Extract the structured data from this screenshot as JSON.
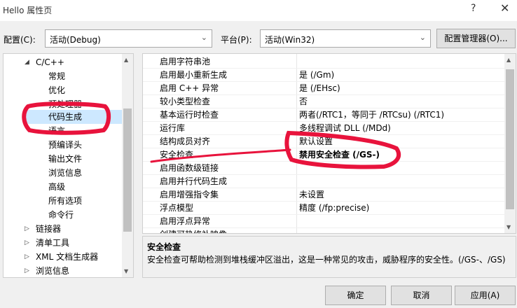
{
  "window": {
    "title": "Hello 属性页",
    "help_glyph": "?",
    "close_glyph": "✕"
  },
  "config": {
    "config_label": "配置(C):",
    "config_value": "活动(Debug)",
    "platform_label": "平台(P):",
    "platform_value": "活动(Win32)",
    "manager_button": "配置管理器(O)..."
  },
  "tree": {
    "items": [
      {
        "label": "C/C++",
        "expander": "◢"
      },
      {
        "label": "常规"
      },
      {
        "label": "优化"
      },
      {
        "label": "预处理器"
      },
      {
        "label": "代码生成"
      },
      {
        "label": "语言"
      },
      {
        "label": "预编译头"
      },
      {
        "label": "输出文件"
      },
      {
        "label": "浏览信息"
      },
      {
        "label": "高级"
      },
      {
        "label": "所有选项"
      },
      {
        "label": "命令行"
      },
      {
        "label": "链接器",
        "expander": "▷"
      },
      {
        "label": "清单工具",
        "expander": "▷"
      },
      {
        "label": "XML 文档生成器",
        "expander": "▷"
      },
      {
        "label": "浏览信息",
        "expander": "▷"
      }
    ],
    "selected_index": 4
  },
  "grid": {
    "rows": [
      {
        "name": "启用字符串池",
        "value": ""
      },
      {
        "name": "启用最小重新生成",
        "value": "是 (/Gm)"
      },
      {
        "name": "启用 C++ 异常",
        "value": "是 (/EHsc)"
      },
      {
        "name": "较小类型检查",
        "value": "否"
      },
      {
        "name": "基本运行时检查",
        "value": "两者(/RTC1，等同于 /RTCsu) (/RTC1)"
      },
      {
        "name": "运行库",
        "value": "多线程调试 DLL (/MDd)"
      },
      {
        "name": "结构成员对齐",
        "value": "默认设置"
      },
      {
        "name": "安全检查",
        "value": "禁用安全检查 (/GS-)"
      },
      {
        "name": "启用函数级链接",
        "value": ""
      },
      {
        "name": "启用并行代码生成",
        "value": ""
      },
      {
        "name": "启用增强指令集",
        "value": "未设置"
      },
      {
        "name": "浮点模型",
        "value": "精度 (/fp:precise)"
      },
      {
        "name": "启用浮点异常",
        "value": ""
      },
      {
        "name": "创建可热修补映像",
        "value": ""
      }
    ],
    "selected_index": 7
  },
  "description": {
    "title": "安全检查",
    "text": "安全检查可帮助检测到堆栈缓冲区溢出，这是一种常见的攻击，威胁程序的安全性。(/GS-、/GS)"
  },
  "buttons": {
    "ok": "确定",
    "cancel": "取消",
    "apply": "应用(A)"
  },
  "colors": {
    "selection": "#cde8ff",
    "annotation": "#e8133c"
  }
}
